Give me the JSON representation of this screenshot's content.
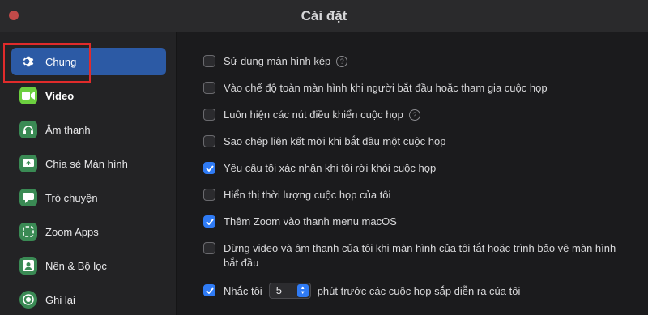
{
  "window": {
    "title": "Cài đặt"
  },
  "colors": {
    "accent": "#2f7bf5",
    "sidebar_active": "#2c5aa5",
    "highlight": "#e02b2b"
  },
  "sidebar": {
    "items": [
      {
        "label": "Chung",
        "icon": "gear-icon",
        "active": true
      },
      {
        "label": "Video",
        "icon": "video-camera-icon",
        "active": false
      },
      {
        "label": "Âm thanh",
        "icon": "headphones-icon",
        "active": false
      },
      {
        "label": "Chia sẻ Màn hình",
        "icon": "share-screen-icon",
        "active": false
      },
      {
        "label": "Trò chuyện",
        "icon": "chat-bubble-icon",
        "active": false
      },
      {
        "label": "Zoom Apps",
        "icon": "apps-icon",
        "active": false
      },
      {
        "label": "Nền & Bộ lọc",
        "icon": "portrait-icon",
        "active": false
      },
      {
        "label": "Ghi lại",
        "icon": "record-icon",
        "active": false
      }
    ]
  },
  "options": [
    {
      "label": "Sử dụng màn hình kép",
      "checked": false,
      "help": true
    },
    {
      "label": "Vào chế độ toàn màn hình khi người bắt đầu hoặc tham gia cuộc họp",
      "checked": false
    },
    {
      "label": "Luôn hiện các nút điều khiển cuộc họp",
      "checked": false,
      "help": true
    },
    {
      "label": "Sao chép liên kết mời khi bắt đầu một cuộc họp",
      "checked": false
    },
    {
      "label": "Yêu cầu tôi xác nhận khi tôi rời khỏi cuộc họp",
      "checked": true
    },
    {
      "label": "Hiển thị thời lượng cuộc họp của tôi",
      "checked": false
    },
    {
      "label": "Thêm Zoom vào thanh menu macOS",
      "checked": true
    },
    {
      "label": "Dừng video và âm thanh của tôi khi màn hình của tôi tắt hoặc trình bảo vệ màn hình bắt đầu",
      "checked": false
    }
  ],
  "reminder": {
    "checked": true,
    "prefix": "Nhắc tôi",
    "value": "5",
    "suffix": "phút trước các cuộc họp sắp diễn ra của tôi"
  }
}
